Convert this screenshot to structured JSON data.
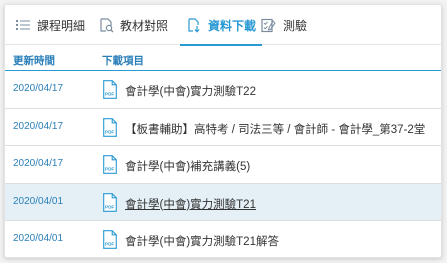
{
  "tabs": [
    {
      "label": "課程明細",
      "icon": "list-icon"
    },
    {
      "label": "教材對照",
      "icon": "book-search-icon"
    },
    {
      "label": "資料下載",
      "icon": "download-doc-icon",
      "active": true
    },
    {
      "label": "測驗",
      "icon": "quiz-icon"
    }
  ],
  "table": {
    "headers": {
      "date": "更新時間",
      "item": "下載項目"
    },
    "rows": [
      {
        "date": "2020/04/17",
        "title": "會計學(中會)實力測驗T22"
      },
      {
        "date": "2020/04/17",
        "title": "【板書輔助】高特考 / 司法三等 / 會計師 - 會計學_第37-2堂"
      },
      {
        "date": "2020/04/17",
        "title": "會計學(中會)補充講義(5)"
      },
      {
        "date": "2020/04/01",
        "title": "會計學(中會)實力測驗T21",
        "highlighted": true
      },
      {
        "date": "2020/04/01",
        "title": "會計學(中會)實力測驗T21解答"
      }
    ],
    "file_badge": "PDF"
  },
  "colors": {
    "accent": "#2a9ad4",
    "header_text": "#2a7fb8",
    "highlight_row": "#e4f0f6"
  }
}
